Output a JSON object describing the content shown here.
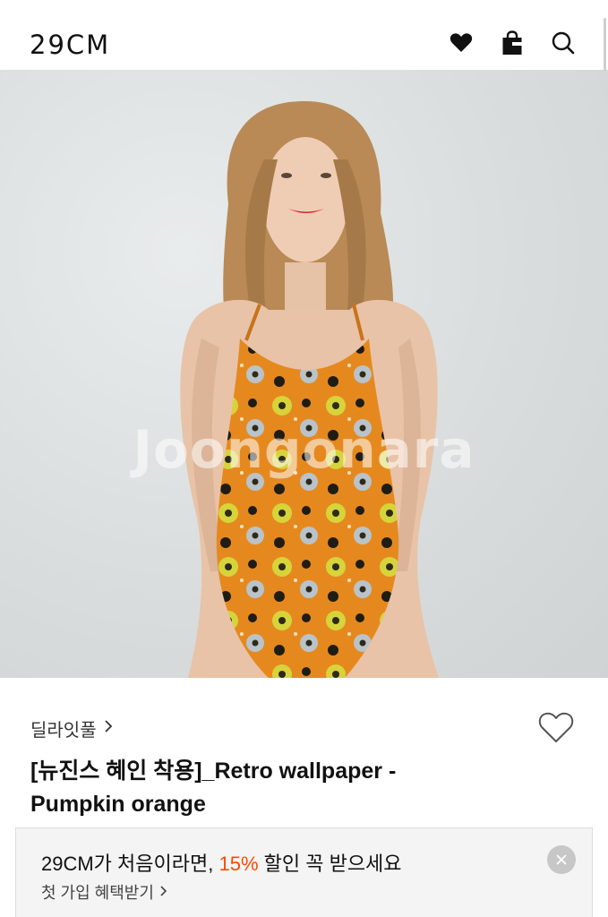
{
  "header": {
    "logo": "29CM",
    "icons": {
      "wishlist": "heart-icon",
      "cart": "shopping-bag-icon",
      "search": "search-icon"
    }
  },
  "hero": {
    "watermark": "Joongonara"
  },
  "product": {
    "brand": "딜라잇풀",
    "title": "[뉴진스 혜인 착용]_Retro wallpaper - Pumpkin orange"
  },
  "promo": {
    "text_before": "29CM가 처음이라면, ",
    "highlight": "15%",
    "text_after": " 할인 꼭 받으세요",
    "link": "첫 가입 혜택받기",
    "highlight_color": "#ff4800"
  }
}
